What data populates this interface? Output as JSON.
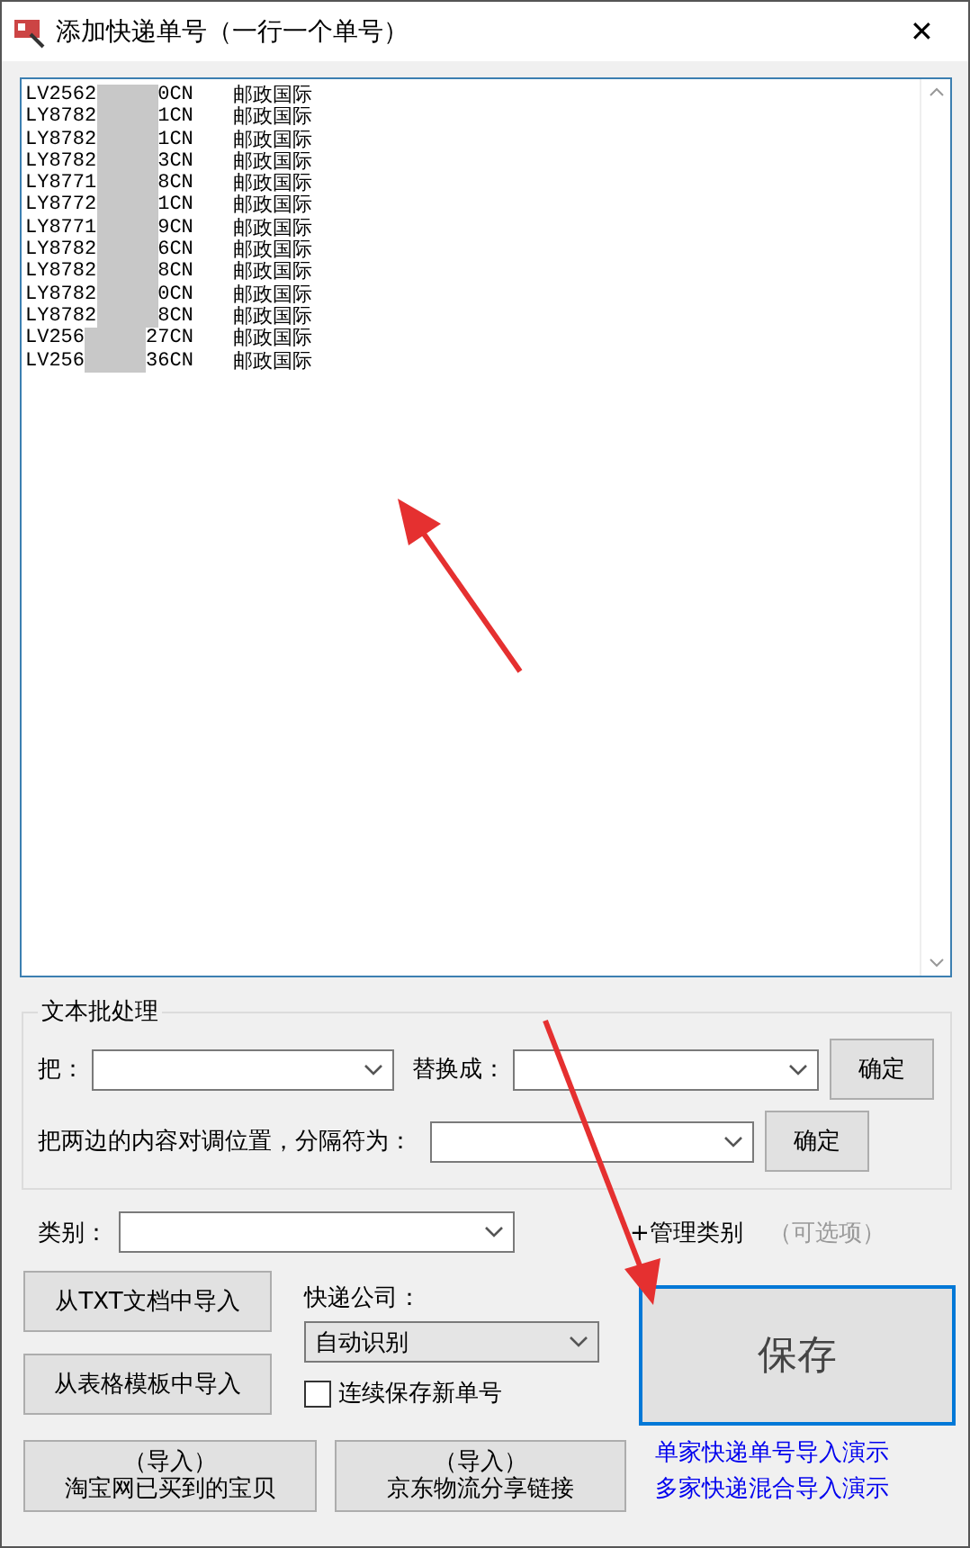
{
  "window": {
    "title": "添加快递单号（一行一个单号）",
    "close": "✕"
  },
  "entries": [
    {
      "prefix": "LV2562",
      "suffix": "0CN",
      "carrier": "邮政国际"
    },
    {
      "prefix": "LY8782",
      "suffix": "1CN",
      "carrier": "邮政国际"
    },
    {
      "prefix": "LY8782",
      "suffix": "1CN",
      "carrier": "邮政国际"
    },
    {
      "prefix": "LY8782",
      "suffix": "3CN",
      "carrier": "邮政国际"
    },
    {
      "prefix": "LY8771",
      "suffix": "8CN",
      "carrier": "邮政国际"
    },
    {
      "prefix": "LY8772",
      "suffix": "1CN",
      "carrier": "邮政国际"
    },
    {
      "prefix": "LY8771",
      "suffix": "9CN",
      "carrier": "邮政国际"
    },
    {
      "prefix": "LY8782",
      "suffix": "6CN",
      "carrier": "邮政国际"
    },
    {
      "prefix": "LY8782",
      "suffix": "8CN",
      "carrier": "邮政国际"
    },
    {
      "prefix": "LY8782",
      "suffix": "0CN",
      "carrier": "邮政国际"
    },
    {
      "prefix": "LY8782",
      "suffix": "8CN",
      "carrier": "邮政国际"
    },
    {
      "prefix": "LV256",
      "suffix": "27CN",
      "carrier": "邮政国际"
    },
    {
      "prefix": "LV256",
      "suffix": "36CN",
      "carrier": "邮政国际"
    }
  ],
  "batch": {
    "title": "文本批处理",
    "find_label": "把：",
    "replace_label": "替换成：",
    "confirm1": "确定",
    "swap_label": "把两边的内容对调位置，分隔符为：",
    "confirm2": "确定"
  },
  "category": {
    "label": "类别：",
    "manage_link": "+管理类别",
    "optional_note": "（可选项）"
  },
  "import_txt": "从TXT文档中导入",
  "import_sheet": "从表格模板中导入",
  "courier": {
    "label": "快递公司：",
    "value": "自动识别"
  },
  "continuous_save": {
    "label": "连续保存新单号",
    "checked": false
  },
  "save": "保存",
  "import_taobao": {
    "line1": "（导入）",
    "line2": "淘宝网已买到的宝贝"
  },
  "import_jd": {
    "line1": "（导入）",
    "line2": "京东物流分享链接"
  },
  "demo_links": [
    "单家快递单号导入演示",
    "多家快递混合导入演示"
  ]
}
